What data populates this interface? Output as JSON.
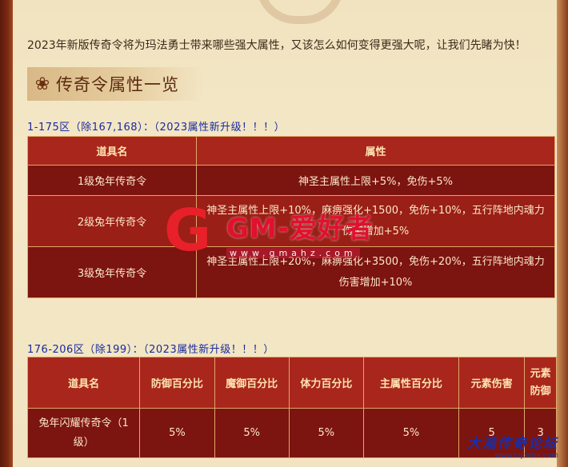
{
  "intro_text": "2023年新版传奇令将为玛法勇士带来哪些强大属性，又该怎么如何变得更强大呢，让我们先睹为快！",
  "section_title": "传奇令属性一览",
  "table1": {
    "heading": "1-175区（除167,168）：（2023属性新升级！！！）",
    "headers": [
      "道具名",
      "属性"
    ],
    "rows": [
      {
        "name": "1级兔年传奇令",
        "attr": "神圣主属性上限+5%，免伤+5%"
      },
      {
        "name": "2级兔年传奇令",
        "attr": "神圣主属性上限+10%，麻痹强化+1500，免伤+10%，五行阵地内魂力伤害增加+5%"
      },
      {
        "name": "3级兔年传奇令",
        "attr": "神圣主属性上限+20%，麻痹强化+3500，免伤+20%，五行阵地内魂力伤害增加+10%"
      }
    ]
  },
  "table2": {
    "heading": "176-206区（除199）：（2023属性新升级！！！）",
    "headers": [
      "道具名",
      "防御百分比",
      "魔御百分比",
      "体力百分比",
      "主属性百分比",
      "元素伤害",
      "元素防御"
    ],
    "rows": [
      {
        "name": "兔年闪耀传奇令（1级）",
        "cells": [
          "5%",
          "5%",
          "5%",
          "5%",
          "5",
          "3"
        ]
      }
    ]
  },
  "watermark": {
    "letter": "G",
    "text": "GM-爱好者",
    "url": "www.gmahz.com"
  },
  "corner_logo": {
    "name": "大渝传奇论坛",
    "url": "www.cqtieba.com"
  }
}
